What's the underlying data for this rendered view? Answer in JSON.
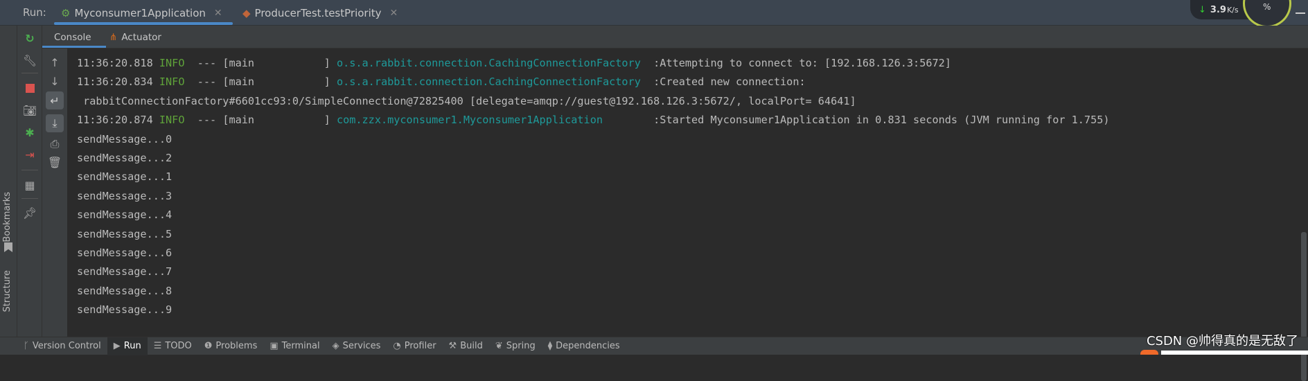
{
  "run_label": "Run:",
  "tabs": [
    {
      "label": "Myconsumer1Application",
      "icon": "spring-boot-icon",
      "active": true
    },
    {
      "label": "ProducerTest.testPriority",
      "icon": "junit-icon",
      "active": false
    }
  ],
  "network": {
    "speed": "3.9",
    "unit": "K/s"
  },
  "cpu_gauge": {
    "value": "71",
    "unit": "%"
  },
  "subtabs": [
    {
      "label": "Console",
      "active": true
    },
    {
      "label": "Actuator",
      "icon": "actuator-icon"
    }
  ],
  "side_labels": {
    "bookmarks": "Bookmarks",
    "structure": "Structure"
  },
  "log": [
    {
      "time": "11:36:20.818",
      "level": "INFO",
      "thread": "--- [main           ]",
      "logger": "o.s.a.rabbit.connection.CachingConnectionFactory ",
      "message": ":Attempting to connect to: [192.168.126.3:5672]"
    },
    {
      "time": "11:36:20.834",
      "level": "INFO",
      "thread": "--- [main           ]",
      "logger": "o.s.a.rabbit.connection.CachingConnectionFactory ",
      "message": ":Created new connection:"
    },
    {
      "text": " rabbitConnectionFactory#6601cc93:0/SimpleConnection@72825400 [delegate=amqp://guest@192.168.126.3:5672/, localPort= 64641]"
    },
    {
      "time": "11:36:20.874",
      "level": "INFO",
      "thread": "--- [main           ]",
      "logger": "com.zzx.myconsumer1.Myconsumer1Application       ",
      "message": ":Started Myconsumer1Application in 0.831 seconds (JVM running for 1.755)"
    },
    {
      "text": "sendMessage...0"
    },
    {
      "text": "sendMessage...2"
    },
    {
      "text": "sendMessage...1"
    },
    {
      "text": "sendMessage...3"
    },
    {
      "text": "sendMessage...4"
    },
    {
      "text": "sendMessage...5"
    },
    {
      "text": "sendMessage...6"
    },
    {
      "text": "sendMessage...7"
    },
    {
      "text": "sendMessage...8"
    },
    {
      "text": "sendMessage...9"
    }
  ],
  "statusbar": [
    {
      "label": "Version Control",
      "icon": "branch-icon"
    },
    {
      "label": "Run",
      "icon": "run-icon",
      "active": true
    },
    {
      "label": "TODO",
      "icon": "list-icon"
    },
    {
      "label": "Problems",
      "icon": "problems-icon"
    },
    {
      "label": "Terminal",
      "icon": "terminal-icon"
    },
    {
      "label": "Services",
      "icon": "services-icon"
    },
    {
      "label": "Profiler",
      "icon": "profiler-icon"
    },
    {
      "label": "Build",
      "icon": "hammer-icon"
    },
    {
      "label": "Spring",
      "icon": "spring-icon"
    },
    {
      "label": "Dependencies",
      "icon": "dependencies-icon"
    }
  ],
  "watermark": "CSDN @帅得真的是无敌了",
  "colors": {
    "info": "#5fa33a",
    "logger": "#1e9a9a",
    "accent": "#4a88c7",
    "stop": "#d9534f"
  }
}
